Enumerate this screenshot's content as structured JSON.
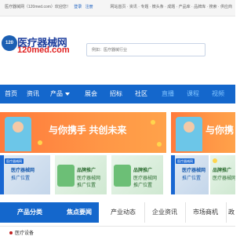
{
  "topbar": {
    "welcome": "医疗器械网（120med.com）欢迎您！",
    "login": "登录",
    "register": "注册",
    "links": "网站首页 · 资讯 · 专题 · 微头条 · 成题 · 产品库 · 品牌库 · 搜索 · 供应商"
  },
  "logo": {
    "badge": "120",
    "title": "医疗器械网",
    "domain": "120med.com"
  },
  "search": {
    "placeholder": "例如：医疗器械行业"
  },
  "nav": {
    "items": [
      {
        "label": "首页",
        "highlight": false
      },
      {
        "label": "资讯",
        "highlight": false
      },
      {
        "label": "产品",
        "highlight": false,
        "dropdown": true
      },
      {
        "label": "展会",
        "highlight": false
      },
      {
        "label": "招标",
        "highlight": false
      },
      {
        "label": "社区",
        "highlight": false
      },
      {
        "label": "直播",
        "highlight": true
      },
      {
        "label": "课程",
        "highlight": true
      },
      {
        "label": "视频",
        "highlight": true
      }
    ]
  },
  "banner": {
    "slogan": "与你携手 共创未来",
    "slogan_short": "与你携"
  },
  "ads": [
    {
      "tag": "医疗器械网",
      "title": "医疗器械网",
      "subtitle": "推广位置",
      "style": "blue"
    },
    {
      "tag": "",
      "title": "品牌推广",
      "subtitle": "医疗器械网",
      "sub2": "推广位置",
      "style": "green"
    },
    {
      "tag": "",
      "title": "品牌推广",
      "subtitle": "医疗器械网",
      "sub2": "推广位置",
      "style": "green"
    },
    {
      "tag": "医疗器械网",
      "title": "医疗器械网",
      "subtitle": "推广位置",
      "style": "blue"
    },
    {
      "tag": "",
      "title": "品牌推广",
      "subtitle": "医疗器械网",
      "sub2": "推广位置",
      "style": "green"
    }
  ],
  "category": {
    "label": "产品分类"
  },
  "tabs": [
    {
      "label": "焦点要闻",
      "active": true
    },
    {
      "label": "产业动态",
      "active": false
    },
    {
      "label": "企业资讯",
      "active": false
    },
    {
      "label": "市场商机",
      "active": false
    },
    {
      "label": "政策",
      "active": false
    }
  ],
  "first_category": "医疗设备"
}
